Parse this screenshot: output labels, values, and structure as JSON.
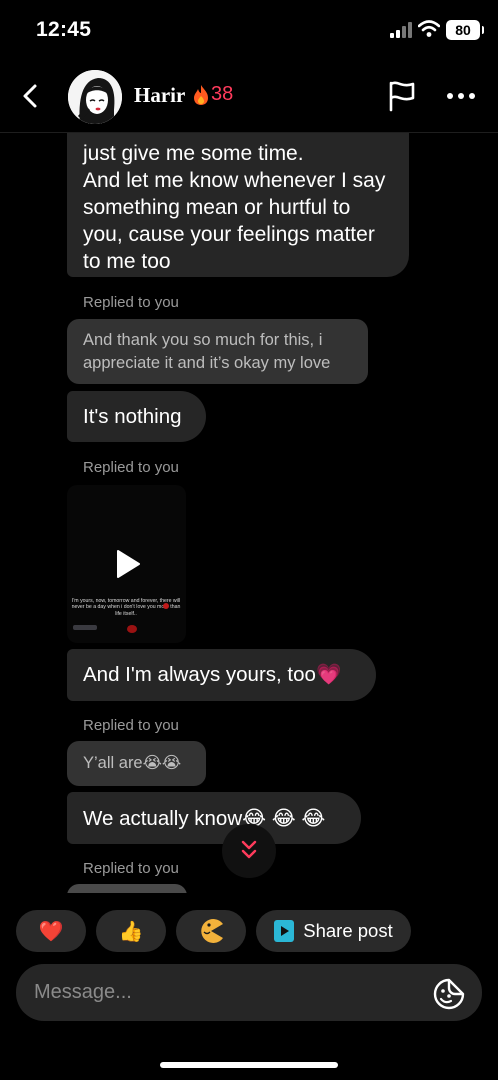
{
  "status_bar": {
    "time": "12:45",
    "battery": "80"
  },
  "header": {
    "name": "Harir",
    "streak": "38"
  },
  "messages": {
    "m1_lines": [
      "just give me some time.",
      "And let me know whenever I say",
      "something mean or hurtful to",
      "you, cause your feelings matter",
      "to me too"
    ],
    "replied_label": "Replied to you",
    "quote1_lines": [
      "And thank you so much for this, i",
      "appreciate it and it’s okay my love"
    ],
    "m2": "It's nothing",
    "video_caption": "I'm yours, now, tomorrow and forever, there will never be a day when i don't love you more than life itself..",
    "m3_text": "And I'm always yours, too",
    "m3_emoji": "💗",
    "quote2": "Y’all are😭😭",
    "m4": "We actually know😂 😂 😂"
  },
  "quick_replies": {
    "heart": "❤️",
    "thumbs": "👍",
    "pacman": "🌕",
    "share_label": "Share post"
  },
  "composer": {
    "placeholder": "Message..."
  },
  "colors": {
    "accent": "#ff3b5c",
    "bubble": "#262626",
    "quote": "#333333",
    "share_icon": "#2bb7d6"
  }
}
